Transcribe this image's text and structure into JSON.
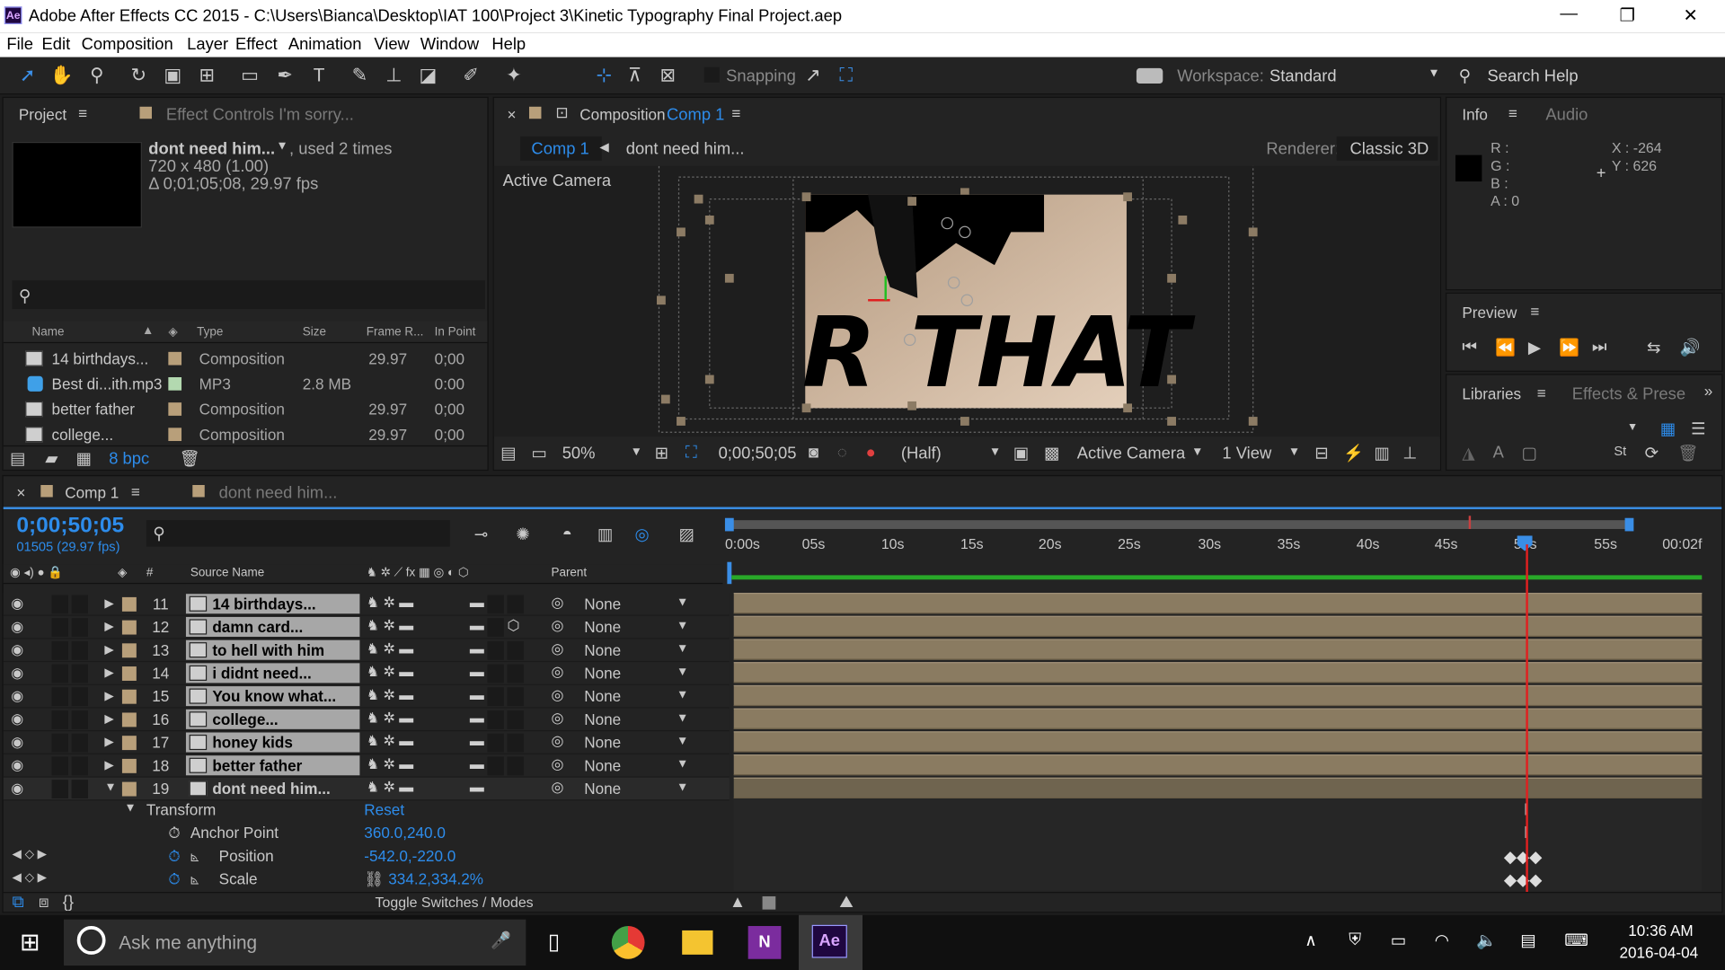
{
  "window": {
    "title": "Adobe After Effects CC 2015 - C:\\Users\\Bianca\\Desktop\\IAT 100\\Project 3\\Kinetic Typography Final Project.aep",
    "app_icon": "Ae"
  },
  "menu": [
    "File",
    "Edit",
    "Composition",
    "Layer",
    "Effect",
    "Animation",
    "View",
    "Window",
    "Help"
  ],
  "toolbar": {
    "snapping": "Snapping",
    "workspace_label": "Workspace:",
    "workspace_value": "Standard",
    "search_help": "Search Help"
  },
  "project": {
    "tab": "Project",
    "effect_tab": "Effect Controls I'm sorry...",
    "item_name": "dont need him...",
    "used": ", used 2 times",
    "dims": "720 x 480 (1.00)",
    "duration": "Δ 0;01;05;08, 29.97 fps",
    "columns": [
      "Name",
      "Type",
      "Size",
      "Frame R...",
      "In Point"
    ],
    "items": [
      {
        "name": "14 birthdays...",
        "type": "Composition",
        "size": "",
        "fps": "29.97",
        "in": "0;00"
      },
      {
        "name": "Best di...ith.mp3",
        "type": "MP3",
        "size": "2.8 MB",
        "fps": "",
        "in": "0:00"
      },
      {
        "name": "better father",
        "type": "Composition",
        "size": "",
        "fps": "29.97",
        "in": "0;00"
      },
      {
        "name": "college...",
        "type": "Composition",
        "size": "",
        "fps": "29.97",
        "in": "0;00"
      }
    ],
    "bpc": "8 bpc"
  },
  "comp": {
    "tab_prefix": "Composition",
    "tab_name": "Comp 1",
    "crumb1": "Comp 1",
    "crumb2": "dont need him...",
    "renderer_label": "Renderer:",
    "renderer": "Classic 3D",
    "active_camera": "Active Camera",
    "zoom": "50%",
    "timecode": "0;00;50;05",
    "resolution": "(Half)",
    "camera": "Active Camera",
    "views": "1 View",
    "big_text": "R THAT"
  },
  "info": {
    "tab": "Info",
    "audio_tab": "Audio",
    "r": "R :",
    "g": "G :",
    "b": "B :",
    "a": "A : 0",
    "x": "X : -264",
    "y": "Y : 626"
  },
  "preview": {
    "title": "Preview"
  },
  "libraries": {
    "tab": "Libraries",
    "effects_tab": "Effects & Prese"
  },
  "timeline": {
    "tab": "Comp 1",
    "tab2": "dont need him...",
    "timecode": "0;00;50;05",
    "frames": "01505 (29.97 fps)",
    "ruler": [
      "0:00s",
      "05s",
      "10s",
      "15s",
      "20s",
      "25s",
      "30s",
      "35s",
      "40s",
      "45s",
      "50s",
      "55s",
      "00:02f"
    ],
    "col_source": "Source Name",
    "col_parent": "Parent",
    "col_num": "#",
    "layers": [
      {
        "num": "11",
        "name": "14 birthdays...",
        "parent": "None"
      },
      {
        "num": "12",
        "name": "damn card...",
        "parent": "None"
      },
      {
        "num": "13",
        "name": "to hell with him",
        "parent": "None"
      },
      {
        "num": "14",
        "name": "i didnt need...",
        "parent": "None"
      },
      {
        "num": "15",
        "name": "You know what...",
        "parent": "None"
      },
      {
        "num": "16",
        "name": "college...",
        "parent": "None"
      },
      {
        "num": "17",
        "name": "honey kids",
        "parent": "None"
      },
      {
        "num": "18",
        "name": "better father",
        "parent": "None"
      },
      {
        "num": "19",
        "name": "dont need him...",
        "parent": "None"
      }
    ],
    "transform": "Transform",
    "reset": "Reset",
    "props": [
      {
        "name": "Anchor Point",
        "value": "360.0,240.0"
      },
      {
        "name": "Position",
        "value": "-542.0,-220.0"
      },
      {
        "name": "Scale",
        "value": "334.2,334.2%"
      }
    ],
    "toggle": "Toggle Switches / Modes"
  },
  "taskbar": {
    "search": "Ask me anything",
    "time": "10:36 AM",
    "date": "2016-04-04"
  }
}
